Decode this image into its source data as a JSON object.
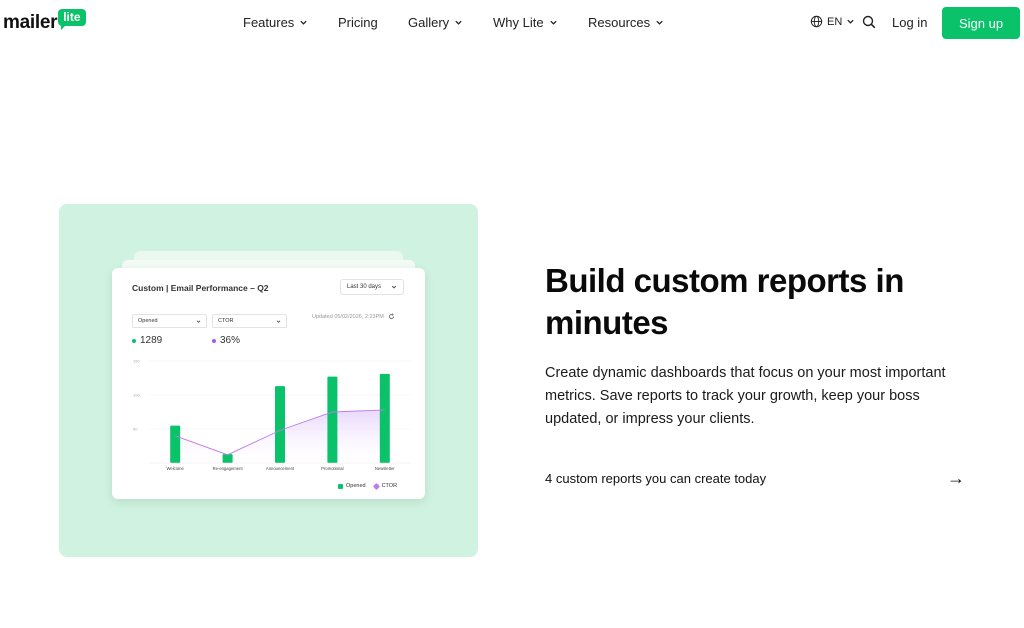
{
  "brand": {
    "word": "mailer",
    "badge": "lite",
    "accent": "#09c269"
  },
  "nav": {
    "features": "Features",
    "pricing": "Pricing",
    "gallery": "Gallery",
    "why_lite": "Why Lite",
    "resources": "Resources"
  },
  "tools": {
    "lang_icon": "globe-icon",
    "lang": "EN",
    "search_icon": "search-icon",
    "login": "Log in",
    "signup": "Sign up"
  },
  "dashboard": {
    "title": "Custom | Email Performance – Q2",
    "range": "Last 30 days",
    "updated": "Updated 05/02/2026, 2:23PM",
    "select_a": "Opened",
    "select_b": "CTOR",
    "metric_a": "1289",
    "metric_b": "36%",
    "metric_a_color": "#09c269",
    "metric_b_color": "#a35cf0",
    "legend_a": "Opened",
    "legend_b": "CTOR"
  },
  "chart_data": {
    "type": "bar",
    "categories": [
      "Welcome",
      "Re-engagement",
      "Announcement",
      "Promotional",
      "Newsletter"
    ],
    "y_ticks": [
      "150",
      "100",
      "50"
    ],
    "ylim": [
      0,
      150
    ],
    "series": [
      {
        "name": "Opened",
        "type": "bar",
        "color": "#09c269",
        "values": [
          55,
          13,
          113,
          127,
          131
        ]
      },
      {
        "name": "CTOR",
        "type": "line",
        "color": "#c07ae8",
        "values": [
          40,
          12,
          48,
          75,
          78
        ]
      }
    ],
    "legend": "bottom-right",
    "grid": true
  },
  "content": {
    "headline": "Build custom reports in minutes",
    "body": "Create dynamic dashboards that focus on your most important metrics. Save reports to track your growth, keep your boss updated, or impress your clients.",
    "link": "4 custom reports you can create today",
    "arrow": "→"
  }
}
